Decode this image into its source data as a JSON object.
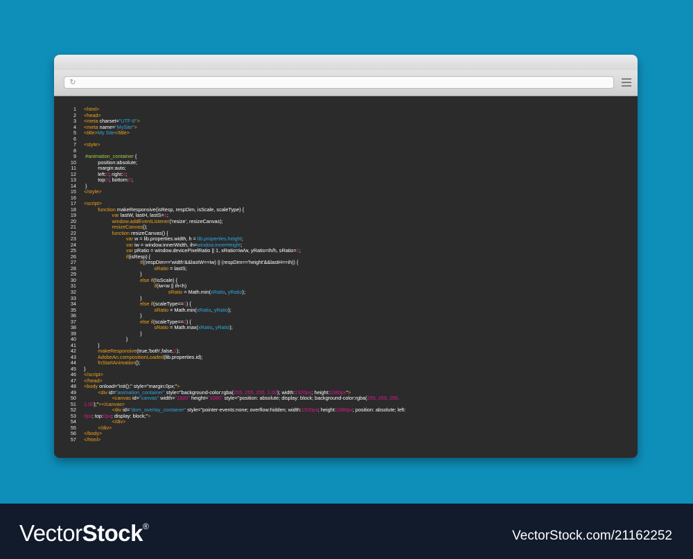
{
  "browser": {
    "reload_icon": "↻",
    "menu_icon": "hamburger-icon"
  },
  "code_lines": [
    {
      "n": "1",
      "html": "<span class=\"tag\">&lt;html&gt;</span>"
    },
    {
      "n": "2",
      "html": "<span class=\"tag\">&lt;head&gt;</span>"
    },
    {
      "n": "3",
      "html": "<span class=\"tag\">&lt;meta</span> charset=<span class=\"str\">\"UTF-8\"</span><span class=\"tag\">&gt;</span>"
    },
    {
      "n": "4",
      "html": "<span class=\"tag\">&lt;meta</span> name=<span class=\"str\">\"MySite\"</span><span class=\"tag\">&gt;</span>"
    },
    {
      "n": "5",
      "html": "<span class=\"tag\">&lt;title&gt;</span><span class=\"str\">My Site</span><span class=\"tag\">&lt;/title&gt;</span>"
    },
    {
      "n": "6",
      "html": ""
    },
    {
      "n": "7",
      "html": "<span class=\"tag\">&lt;style&gt;</span>"
    },
    {
      "n": "8",
      "html": ""
    },
    {
      "n": "9",
      "html": " <span class=\"green\">#animation_container</span> {"
    },
    {
      "n": "10",
      "html": "          position:absolute;"
    },
    {
      "n": "11",
      "html": "          margin:auto;"
    },
    {
      "n": "12",
      "html": "          left:<span class=\"num\">0</span>; right:<span class=\"num\">0</span>;"
    },
    {
      "n": "13",
      "html": "          top:<span class=\"num\">0</span>; bottom:<span class=\"num\">0</span>;"
    },
    {
      "n": "14",
      "html": " }"
    },
    {
      "n": "15",
      "html": "<span class=\"tag\">&lt;/style&gt;</span>"
    },
    {
      "n": "16",
      "html": ""
    },
    {
      "n": "17",
      "html": "<span class=\"tag\">&lt;script&gt;</span>"
    },
    {
      "n": "18",
      "html": "          <span class=\"kw\">function</span> makeResponsive(isResp, respDim, isScale, scaleType) {"
    },
    {
      "n": "19",
      "html": "                    <span class=\"kw\">var</span> lastW, lastH, lastS=<span class=\"num\">1</span>;"
    },
    {
      "n": "20",
      "html": "                    <span class=\"fn\">window.addEventListener</span>('resize', resizeCanvas);"
    },
    {
      "n": "21",
      "html": "                    <span class=\"fn\">resizeCanvas</span>();"
    },
    {
      "n": "22",
      "html": "                    <span class=\"kw\">function</span> resizeCanvas() {"
    },
    {
      "n": "23",
      "html": "                              <span class=\"kw\">var</span> w = lib.properties.width, h = <span class=\"str\">lib.properties.height</span>;"
    },
    {
      "n": "24",
      "html": "                              <span class=\"kw\">var</span> iw = window.innerWidth, ih=<span class=\"str\">window.innerHeight</span>;"
    },
    {
      "n": "25",
      "html": "                              <span class=\"kw\">var</span> pRatio = window.devicePixelRatio || 1, xRatio=iw/w, yRatio=ih/h, sRatio=<span class=\"num\">1</span>;"
    },
    {
      "n": "26",
      "html": "                              <span class=\"kw\">if</span>(isResp) {"
    },
    {
      "n": "27",
      "html": "                                        <span class=\"kw\">if</span>((respDim=='width'&amp;&amp;lastW==iw) || (respDim=='height'&amp;&amp;lastH==ih)) {"
    },
    {
      "n": "28",
      "html": "                                                  <span class=\"var\">sRatio</span> = lastS;"
    },
    {
      "n": "29",
      "html": "                                        }"
    },
    {
      "n": "30",
      "html": "                                        <span class=\"kw\">else if</span>(!isScale) {"
    },
    {
      "n": "31",
      "html": "                                                  <span class=\"kw\">if</span>(iw&lt;w || ih&lt;h)"
    },
    {
      "n": "32",
      "html": "                                                            <span class=\"var\">sRatio</span> = Math.min(<span class=\"str\">xRatio</span>, <span class=\"str\">yRatio</span>);"
    },
    {
      "n": "33",
      "html": "                                        }"
    },
    {
      "n": "34",
      "html": "                                        <span class=\"kw\">else if</span>(scaleType==<span class=\"num\">1</span>) {"
    },
    {
      "n": "35",
      "html": "                                                  <span class=\"var\">sRatio</span> = Math.min(<span class=\"str\">xRatio</span>, <span class=\"str\">yRatio</span>);"
    },
    {
      "n": "36",
      "html": "                                        }"
    },
    {
      "n": "37",
      "html": "                                        <span class=\"kw\">else if</span>(scaleType==<span class=\"num\">2</span>) {"
    },
    {
      "n": "38",
      "html": "                                                  <span class=\"var\">sRatio</span> = Math.max(<span class=\"str\">xRatio</span>, <span class=\"str\">yRatio</span>);"
    },
    {
      "n": "39",
      "html": "                                        }"
    },
    {
      "n": "40",
      "html": "                              }"
    },
    {
      "n": "41",
      "html": "          }"
    },
    {
      "n": "42",
      "html": "          <span class=\"fn\">makeResponsive</span>(true,'both',false,<span class=\"num\">1</span>);"
    },
    {
      "n": "43",
      "html": "          <span class=\"fn\">AdobeAn.compositionLoaded</span>(lib.properties.id);"
    },
    {
      "n": "44",
      "html": "          <span class=\"fn\">fnStartAnimation</span>();"
    },
    {
      "n": "45",
      "html": "}"
    },
    {
      "n": "46",
      "html": "<span class=\"tag\">&lt;/script&gt;</span>"
    },
    {
      "n": "47",
      "html": "<span class=\"tag\">&lt;/head&gt;</span>"
    },
    {
      "n": "48",
      "html": "<span class=\"tag\">&lt;body</span> onload=\"init();\" style=\"margin:0px;\"<span class=\"tag\">&gt;</span>"
    },
    {
      "n": "49",
      "html": "          <span class=\"tag\">&lt;div</span> id=<span class=\"str\">\"animation_container\"</span> style=\"background-color:rgba(<span class=\"num\">255, 255, 255, 1.00</span>); width:<span class=\"num\">1920px</span>; height:<span class=\"num\">1080px</span>\"<span class=\"tag\">&gt;</span>"
    },
    {
      "n": "50",
      "html": "                    <span class=\"tag\">&lt;canvas</span> id=<span class=\"str\">\"canvas\"</span> width=<span class=\"num\">\"1920\"</span> height=<span class=\"num\">\"1080\"</span> style=\"position: absolute; display: block; background-color:rgba(<span class=\"num\">255, 255, 255,</span>"
    },
    {
      "n": "51",
      "html": "<span class=\"num\">1.00</span>);\"<span class=\"tag\">&gt;&lt;/canvas&gt;</span>"
    },
    {
      "n": "52",
      "html": "                    <span class=\"tag\">&lt;div</span> id=<span class=\"str\">\"dom_overlay_container\"</span> style=\"pointer-events:none; overflow:hidden; width:<span class=\"num\">1920px</span>; height:<span class=\"num\">1080px</span>; position: absolute; left:"
    },
    {
      "n": "53",
      "html": "<span class=\"num\">0px</span>; top:<span class=\"num\">0px</span>; display: block;\"<span class=\"tag\">&gt;</span>"
    },
    {
      "n": "54",
      "html": "                    <span class=\"tag\">&lt;/div&gt;</span>"
    },
    {
      "n": "55",
      "html": "          <span class=\"tag\">&lt;/div&gt;</span>"
    },
    {
      "n": "56",
      "html": "<span class=\"tag\">&lt;/body&gt;</span>"
    },
    {
      "n": "57",
      "html": "<span class=\"tag\">&lt;/html&gt;</span>"
    }
  ],
  "footer": {
    "logo_regular": "Vector",
    "logo_bold": "Stock",
    "logo_mark": "®",
    "image_id": "VectorStock.com/21162252"
  }
}
